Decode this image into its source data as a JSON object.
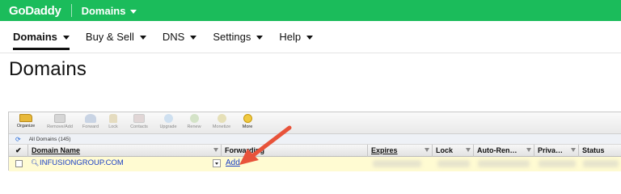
{
  "topbar": {
    "logo": "GoDaddy",
    "menu": "Domains"
  },
  "nav": [
    {
      "label": "Domains",
      "active": true
    },
    {
      "label": "Buy & Sell"
    },
    {
      "label": "DNS"
    },
    {
      "label": "Settings"
    },
    {
      "label": "Help"
    }
  ],
  "page": {
    "title": "Domains"
  },
  "toolbar": [
    {
      "label": "Organize",
      "icon": "folder-icon",
      "enabled": true
    },
    {
      "label": "Remove/Add",
      "icon": "remove-icon",
      "enabled": false
    },
    {
      "label": "Forward",
      "icon": "forward-icon",
      "enabled": false
    },
    {
      "label": "Lock",
      "icon": "lock-icon",
      "enabled": false
    },
    {
      "label": "Contacts",
      "icon": "contacts-icon",
      "enabled": false
    },
    {
      "label": "Upgrade",
      "icon": "upgrade-icon",
      "enabled": false
    },
    {
      "label": "Renew",
      "icon": "renew-icon",
      "enabled": false
    },
    {
      "label": "Monetize",
      "icon": "monetize-icon",
      "enabled": false
    },
    {
      "label": "More",
      "icon": "more-icon",
      "enabled": true
    }
  ],
  "filter": {
    "label": "All Domains (145)"
  },
  "table": {
    "headers": {
      "check": "✔",
      "domain": "Domain Name",
      "forwarding": "Forwarding",
      "expires": "Expires",
      "lock": "Lock",
      "autorenew": "Auto-Ren…",
      "privacy": "Priva…",
      "status": "Status"
    },
    "row": {
      "domain": "INFUSIONGROUP.COM",
      "forwarding": "Add"
    }
  },
  "colors": {
    "brand_green": "#1bbc5b",
    "link": "#1a3fc4",
    "row_highlight": "#fffbd2",
    "arrow": "#e8533a"
  }
}
